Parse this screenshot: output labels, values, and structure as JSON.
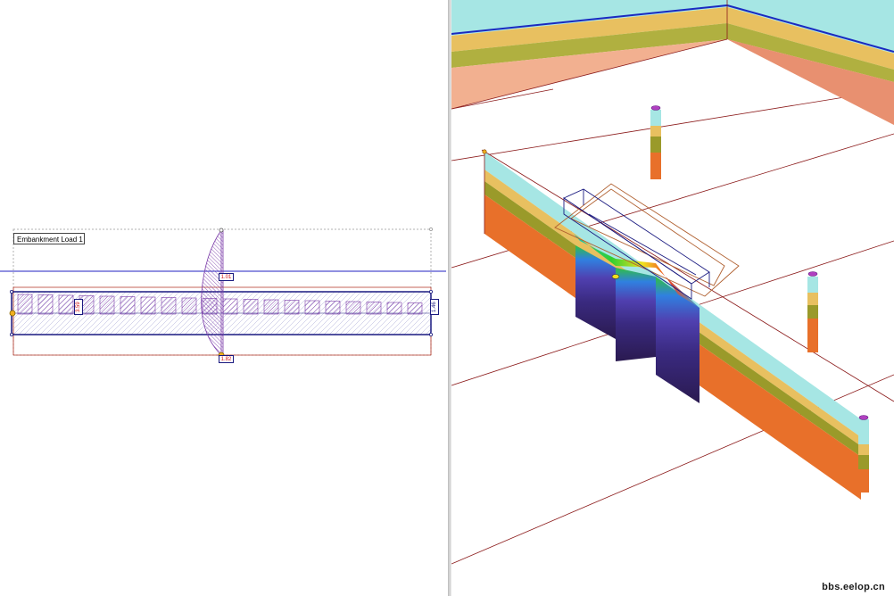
{
  "plan_view": {
    "load_label": "Embankment Load 1",
    "dimension_top": "1.01",
    "dimension_bottom": "1.82",
    "dimension_left": "3.59",
    "dimension_right": "1.46"
  },
  "model_view": {
    "borehole_count": 3
  },
  "watermark": "bbs.eelop.cn",
  "colors": {
    "selection_outline": "#1a1a80",
    "load_hatch": "#7a3aa8",
    "grid_line": "#8b1a1a",
    "layer_cyan": "#a6e6e4",
    "layer_yellow": "#e8c060",
    "layer_olive": "#9a9a2a",
    "layer_orange": "#e8702a",
    "layer_salmon": "#f2b090"
  }
}
